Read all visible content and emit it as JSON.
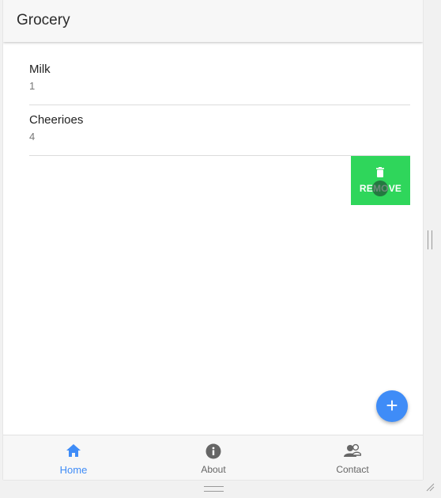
{
  "appbar": {
    "title": "Grocery"
  },
  "items": [
    {
      "name": "Milk",
      "quantity": "1"
    },
    {
      "name": "Cheerioes",
      "quantity": "4"
    }
  ],
  "swipe_action": {
    "label": "REMOVE",
    "icon": "trash-icon",
    "color": "#2fd65b"
  },
  "fab": {
    "icon": "plus-icon",
    "symbol": "+",
    "color": "#3f8cf7"
  },
  "bottom_nav": {
    "active_color": "#3f8cf7",
    "items": [
      {
        "label": "Home",
        "icon": "home-icon",
        "active": true
      },
      {
        "label": "About",
        "icon": "info-icon",
        "active": false
      },
      {
        "label": "Contact",
        "icon": "contacts-icon",
        "active": false
      }
    ]
  }
}
